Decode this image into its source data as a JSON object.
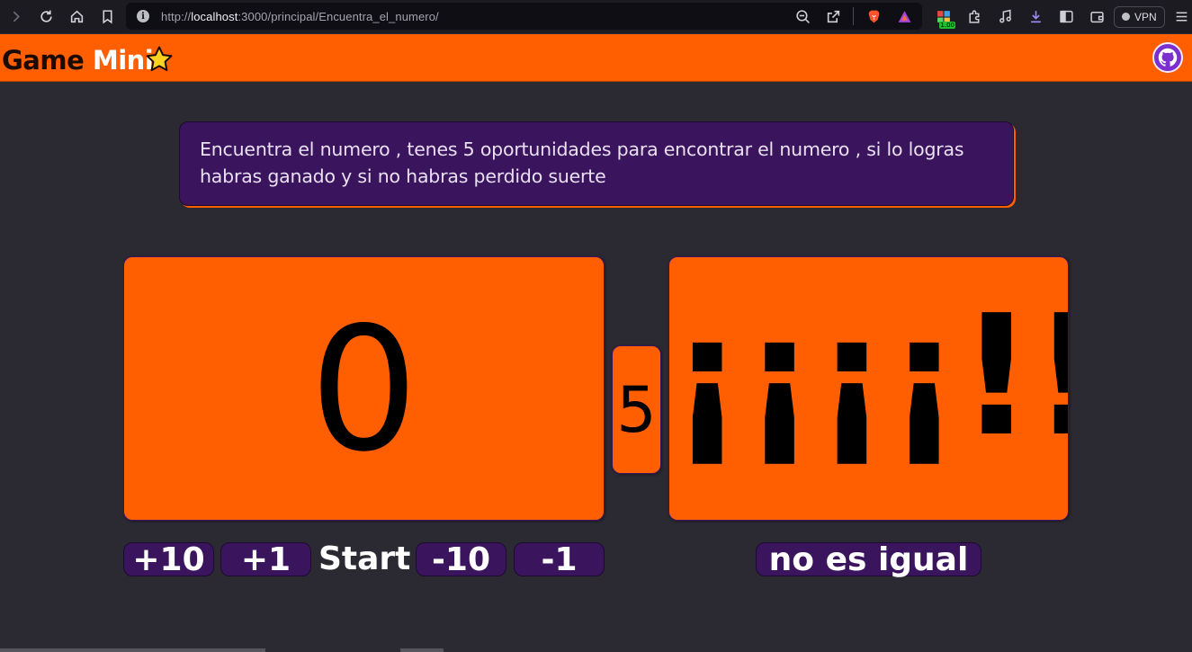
{
  "browser": {
    "url_scheme": "http://",
    "url_host": "localhost",
    "url_path": ":3000/principal/Encuentra_el_numero/",
    "vpn_label": "VPN",
    "badge_count": "1.00",
    "icons": {
      "back": "chevron-right-icon",
      "reload": "reload-icon",
      "home": "home-icon",
      "bookmark": "bookmark-icon",
      "info": "info-icon",
      "zoom": "zoom-out-icon",
      "share": "share-icon",
      "brave": "brave-lion-icon",
      "rewards": "triangle-icon",
      "extensions": "puzzle-icon",
      "media": "music-icon",
      "downloads": "download-icon",
      "sidebar": "sidebar-icon",
      "wallet": "wallet-icon",
      "menu": "hamburger-menu-icon"
    }
  },
  "header": {
    "title_part1": "Game ",
    "title_part2": "Mini",
    "star_icon": "star-icon",
    "github_icon": "github-icon"
  },
  "game": {
    "instructions": "Encuentra el numero , tenes 5 oportunidades para encontrar el numero , si lo logras habras ganado y si no habras perdido suerte",
    "current_number": "0",
    "tries_left": "5",
    "result_message": "¡¡¡¡!!!",
    "buttons": {
      "plus10": "+10",
      "plus1": "+1",
      "start": "Start",
      "minus10": "-10",
      "minus1": "-1",
      "compare": "no es igual"
    }
  },
  "colors": {
    "accent": "#ff5f00",
    "purple": "#3a155e",
    "background": "#2b2a33"
  }
}
